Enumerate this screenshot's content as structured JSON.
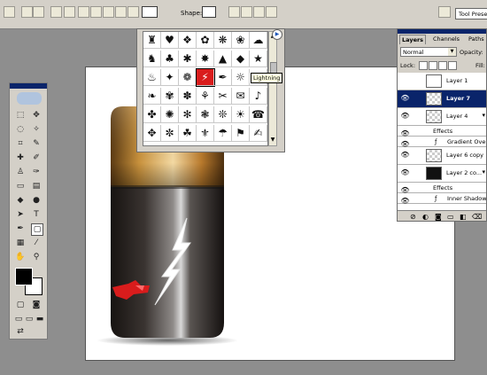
{
  "options_bar": {
    "shape_label": "Shape:",
    "tool_preset_label": "Tool Presets"
  },
  "shape_picker": {
    "tooltip": "Lightning",
    "grid_rows": [
      [
        "♜",
        "♥",
        "❖",
        "✿",
        "❋",
        "❀",
        "☁"
      ],
      [
        "♞",
        "♣",
        "✱",
        "✸",
        "▲",
        "◆",
        "★"
      ],
      [
        "♨",
        "✦",
        "❁",
        "⚡",
        "✒",
        "☼",
        "✈"
      ],
      [
        "❧",
        "✾",
        "✽",
        "⚘",
        "✂",
        "✉",
        "♪"
      ],
      [
        "✤",
        "✺",
        "✻",
        "❃",
        "❊",
        "☀",
        "☎"
      ],
      [
        "✥",
        "✼",
        "☘",
        "⚜",
        "☂",
        "⚑",
        "✍"
      ]
    ]
  },
  "layers_panel": {
    "tabs": [
      "Layers",
      "Channels",
      "Paths"
    ],
    "blend_mode": "Normal",
    "opacity_label": "Opacity:",
    "lock_label": "Lock:",
    "fill_label": "Fill:",
    "layers": [
      {
        "name": "Layer 1",
        "selected": false,
        "effects": false
      },
      {
        "name": "Layer 7",
        "selected": true,
        "effects": false
      },
      {
        "name": "Layer 4",
        "selected": false,
        "effects": true
      },
      {
        "name": "Effects",
        "sub": true
      },
      {
        "name": "Gradient Overlay",
        "sub": true,
        "effect": true
      },
      {
        "name": "Layer 6 copy",
        "selected": false,
        "effects": false
      },
      {
        "name": "Layer 2 co...",
        "selected": false,
        "effects": true
      },
      {
        "name": "Effects",
        "sub": true
      },
      {
        "name": "Inner Shadow",
        "sub": true,
        "effect": true
      }
    ]
  },
  "colors": {
    "accent": "#0a246a",
    "battery_cap": "#c8913c",
    "battery_body": "#2a2523",
    "lightning_red": "#d91c1c"
  }
}
